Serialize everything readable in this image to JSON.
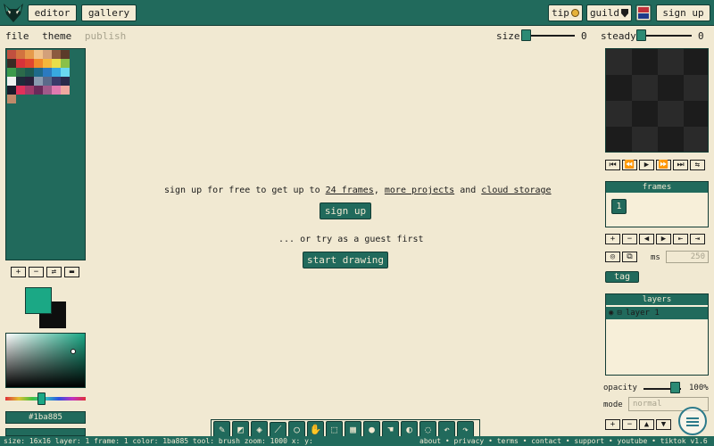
{
  "topbar": {
    "editor_label": "editor",
    "gallery_label": "gallery",
    "tip_label": "tip",
    "guild_label": "guild",
    "signup_label": "sign up"
  },
  "menu": {
    "file": "file",
    "theme": "theme",
    "publish": "publish"
  },
  "controls": {
    "size_label": "size",
    "size_value": "0",
    "steady_label": "steady",
    "steady_value": "0"
  },
  "palette": {
    "colors": [
      "#c0503f",
      "#d2733f",
      "#e69a4a",
      "#f0c28a",
      "#d3a07a",
      "#8c5a3f",
      "#5b3b2a",
      "#3b2a24",
      "#d8323a",
      "#e0462f",
      "#f08a2c",
      "#f4b73c",
      "#e8de4a",
      "#8ac048",
      "#3c9a4c",
      "#2c6a4a",
      "#1f5a50",
      "#1f6a8a",
      "#2c7ac0",
      "#38a8e0",
      "#6ad8f0",
      "#f0f0f0",
      "#1f2a3a",
      "#2a1f3a",
      "#8a9ab0",
      "#5a6a8a",
      "#3a3a6a",
      "#2a2a4a",
      "#1a1a2a",
      "#e0305a",
      "#a03a6a",
      "#6a2a5a",
      "#a05a8a",
      "#e07ab0",
      "#f0a8a0",
      "#c08a6a"
    ],
    "primary_color": "#1ba885",
    "secondary_color": "#0e0e0e",
    "hex_value": "#1ba885"
  },
  "main": {
    "signup_prefix": "sign up for free to get up to",
    "frames_link": "24 frames",
    "comma": ",",
    "projects_link": "more projects",
    "and_text": "and",
    "storage_link": "cloud storage",
    "signup_button": "sign up",
    "guest_text": "... or try as a guest first",
    "start_button": "start drawing"
  },
  "right": {
    "frames_title": "frames",
    "frame_number": "1",
    "ms_label": "ms",
    "ms_value": "250",
    "tag_label": "tag",
    "layers_title": "layers",
    "layer_name": "layer 1",
    "opacity_label": "opacity",
    "opacity_value": "100%",
    "mode_label": "mode",
    "mode_value": "normal"
  },
  "statusbar": {
    "text": "size: 16x16  layer: 1  frame: 1  color: 1ba885  tool: brush  zoom: 1000  x:  y:",
    "links": "about • privacy • terms • contact • support • youtube • tiktok  v1.6"
  },
  "colors": {
    "accent": "#216a5c",
    "background": "#f1e9d2",
    "dark": "#123c34"
  },
  "icons": {
    "logo": "wolf-logo-icon",
    "tip": "coin-icon",
    "guild": "shield-icon",
    "flag": "flag-icon"
  }
}
